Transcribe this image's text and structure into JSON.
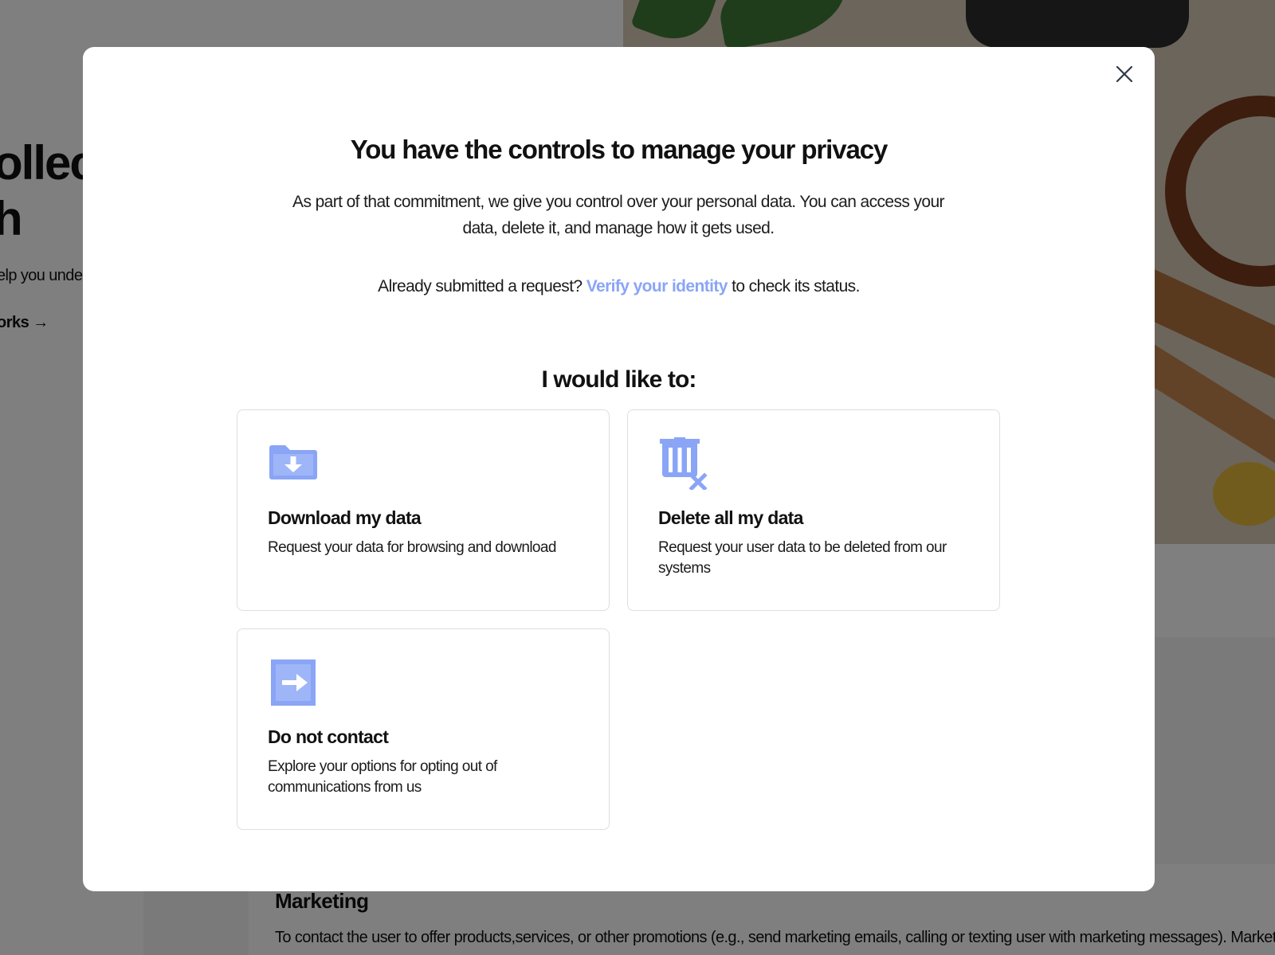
{
  "background": {
    "hero_title": "ollec\nh",
    "hero_subtitle": "elp you under",
    "hero_link": "orks →",
    "section_title": "Marketing",
    "section_text": "To contact the user to offer products,services, or other promotions (e.g., send marketing emails, calling or texting user with marketing messages). Marketing t"
  },
  "modal": {
    "close_icon": "close-icon",
    "title": "You have the controls to manage your privacy",
    "description": "As part of that commitment, we give you control over your personal data. You can access your data, delete it, and manage how it gets used.",
    "status_prefix": "Already submitted a request?",
    "status_link": "Verify your identity",
    "status_suffix": "to check its status.",
    "choose_heading": "I would like to:",
    "accent_color": "#8aa5f6",
    "options": [
      {
        "icon": "folder-download-icon",
        "title": "Download my data",
        "description": "Request your data for browsing and download"
      },
      {
        "icon": "trash-delete-icon",
        "title": "Delete all my data",
        "description": "Request your user data to be deleted from our systems"
      },
      {
        "icon": "exit-arrow-icon",
        "title": "Do not contact",
        "description": "Explore your options for opting out of communications from us"
      }
    ]
  }
}
